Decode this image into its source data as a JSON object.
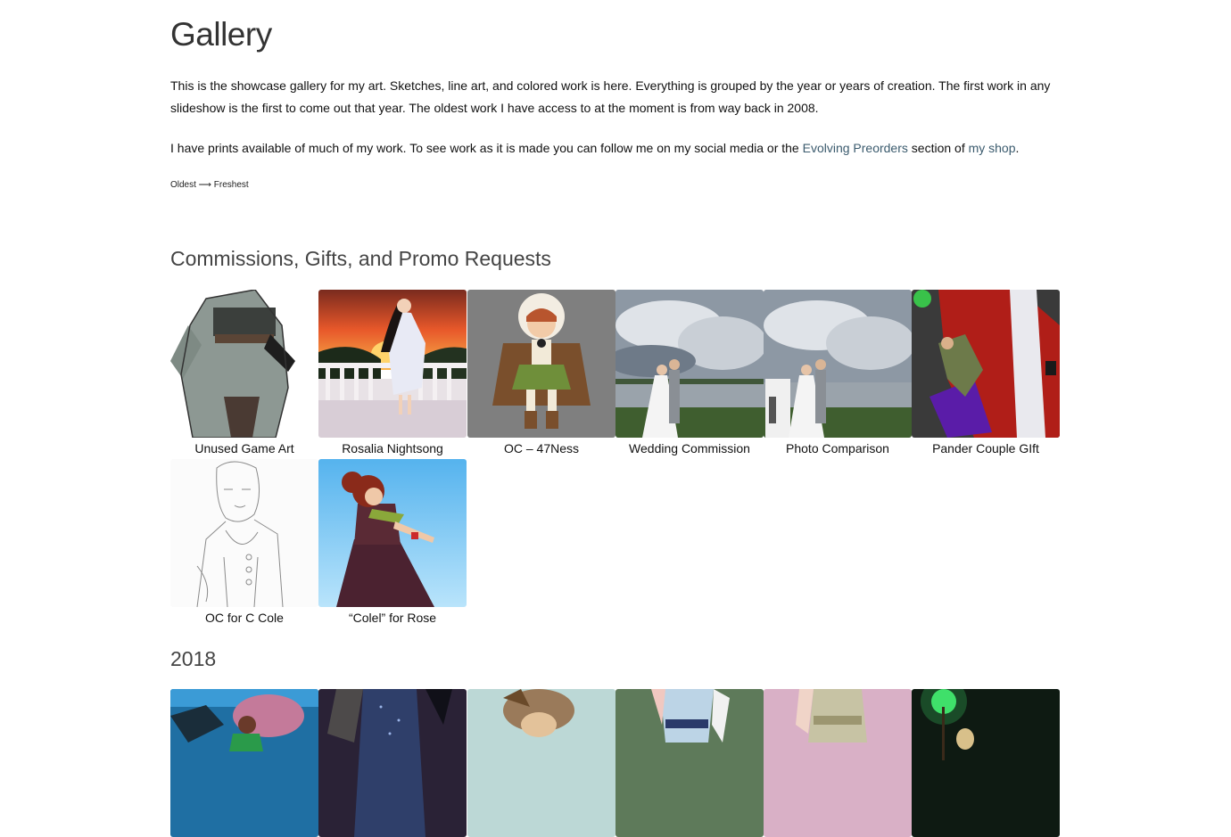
{
  "page": {
    "title": "Gallery",
    "intro_paragraph": "This is the showcase gallery for my art.  Sketches, line art, and colored work is here.  Everything is grouped by the year or years of creation.  The first work in any slideshow is the first to come out that year.  The oldest work I have access to at the moment is from way back in 2008.",
    "prints_text_before": "I have prints available of much of my work.  To see work as it is made you can follow me on my social media or the ",
    "preorders_link": "Evolving  Preorders",
    "prints_text_middle": " section of ",
    "shop_link": "my shop",
    "prints_text_end": ".",
    "order_note": "Oldest ⟶ Freshest"
  },
  "sections": [
    {
      "title": "Commissions, Gifts, and Promo Requests",
      "items": [
        {
          "caption": "Unused Game Art",
          "thumb": "gray-coat-figure"
        },
        {
          "caption": "Rosalia Nightsong",
          "thumb": "sunset-balcony"
        },
        {
          "caption": "OC – 47Ness",
          "thumb": "chibi-cloak"
        },
        {
          "caption": "Wedding Commission",
          "thumb": "wedding-lake"
        },
        {
          "caption": "Photo Comparison",
          "thumb": "wedding-comparison"
        },
        {
          "caption": "Pander Couple GIft",
          "thumb": "mecha-red"
        },
        {
          "caption": "OC for C Cole",
          "thumb": "pencil-sketch"
        },
        {
          "caption": "“Colel” for Rose",
          "thumb": "dancer-blue"
        }
      ]
    },
    {
      "title": "2018",
      "items": [
        {
          "caption": "",
          "thumb": "underwater"
        },
        {
          "caption": "",
          "thumb": "dark-gown"
        },
        {
          "caption": "",
          "thumb": "fur-hat"
        },
        {
          "caption": "",
          "thumb": "green-dress"
        },
        {
          "caption": "",
          "thumb": "pink-gown"
        },
        {
          "caption": "",
          "thumb": "green-magic"
        }
      ]
    }
  ]
}
